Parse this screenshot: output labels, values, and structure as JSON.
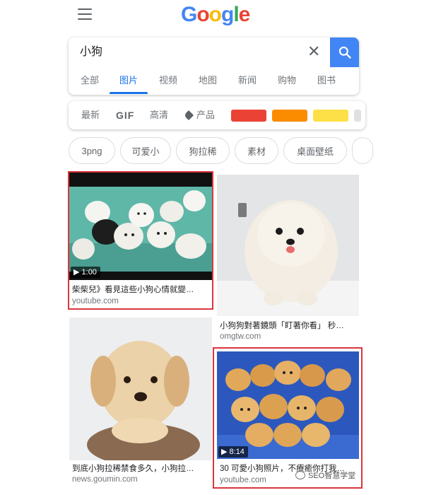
{
  "header": {
    "logo_letters": [
      {
        "ch": "G",
        "color": "#4285F4"
      },
      {
        "ch": "o",
        "color": "#EA4335"
      },
      {
        "ch": "o",
        "color": "#FBBC05"
      },
      {
        "ch": "g",
        "color": "#4285F4"
      },
      {
        "ch": "l",
        "color": "#34A853"
      },
      {
        "ch": "e",
        "color": "#EA4335"
      }
    ]
  },
  "search": {
    "query": "小狗",
    "clear_icon": "close-icon",
    "search_icon": "search-icon",
    "button_color": "#4285f4"
  },
  "tabs": [
    "全部",
    "图片",
    "视频",
    "地图",
    "新闻",
    "购物",
    "图书"
  ],
  "active_tab": "图片",
  "filters": {
    "newest": "最新",
    "gif": "GIF",
    "hd": "高清",
    "product": "产品",
    "color_swatches": [
      "#ea4335",
      "#fb8c00",
      "#fde047",
      "#e0e0e0"
    ]
  },
  "chips": [
    "3png",
    "可爱小",
    "狗拉稀",
    "素材",
    "桌面壁纸"
  ],
  "results": [
    {
      "caption": "柴柴兒》看見這些小狗心情就變…",
      "source": "youtube.com",
      "duration": "1:00",
      "highlighted": true
    },
    {
      "caption": "小狗狗對著鏡頭「盯著你看」 秒…",
      "source": "omgtw.com"
    },
    {
      "caption": "到底小狗拉稀禁食多久，小狗拉…",
      "source": "news.goumin.com"
    },
    {
      "caption": "30 可愛小狗照片，不療癒你打我…",
      "source": "youtube.com",
      "duration": "8:14",
      "highlighted": true
    }
  ],
  "watermark": "SEO智慧学堂",
  "colors": {
    "accent": "#1a73e8",
    "highlight": "#d9363e"
  }
}
